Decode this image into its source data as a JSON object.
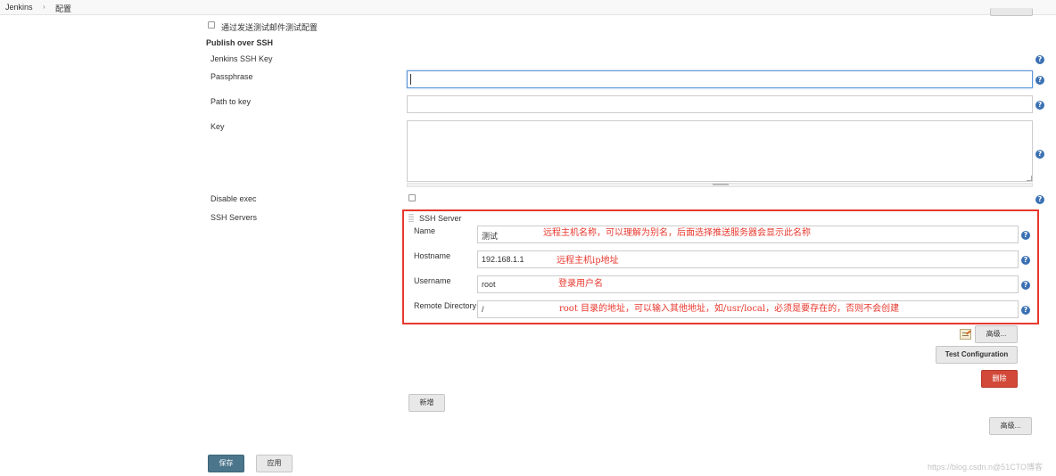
{
  "breadcrumb": {
    "root": "Jenkins",
    "separator": "›",
    "current": "配置"
  },
  "email_test": {
    "label": "通过发送测试邮件测试配置"
  },
  "publish_over_ssh": {
    "title": "Publish over SSH",
    "jenkins_ssh_key_label": "Jenkins SSH Key",
    "passphrase_label": "Passphrase",
    "passphrase_value": "",
    "path_to_key_label": "Path to key",
    "path_to_key_value": "",
    "key_label": "Key",
    "key_value": "",
    "disable_exec_label": "Disable exec",
    "ssh_servers_label": "SSH Servers"
  },
  "ssh_server": {
    "title": "SSH Server",
    "name_label": "Name",
    "name_value": "测试",
    "hostname_label": "Hostname",
    "hostname_value": "192.168.1.1",
    "username_label": "Username",
    "username_value": "root",
    "remote_dir_label": "Remote Directory",
    "remote_dir_value": "/"
  },
  "annotations": {
    "name": "远程主机名称，可以理解为别名，后面选择推送服务器会显示此名称",
    "hostname": "远程主机ip地址",
    "username": "登录用户名",
    "remote_dir": "root 目录的地址，可以输入其他地址，如/usr/local，必须是要存在的，否则不会创建"
  },
  "buttons": {
    "advanced_server": "高级...",
    "test_configuration": "Test Configuration",
    "delete": "删除",
    "add": "新增",
    "advanced_global": "高级...",
    "save": "保存",
    "apply": "应用"
  },
  "help_icon_glyph": "?",
  "watermark": "https://blog.csdn.n@51CTO博客",
  "colors": {
    "annotation_red": "#e8382e",
    "help_blue": "#3b71b3",
    "save_button": "#4b758b",
    "delete_button": "#d24939"
  },
  "icons": [
    "chevron-right-icon",
    "help-icon",
    "notepad-icon",
    "drag-handle-icon"
  ]
}
